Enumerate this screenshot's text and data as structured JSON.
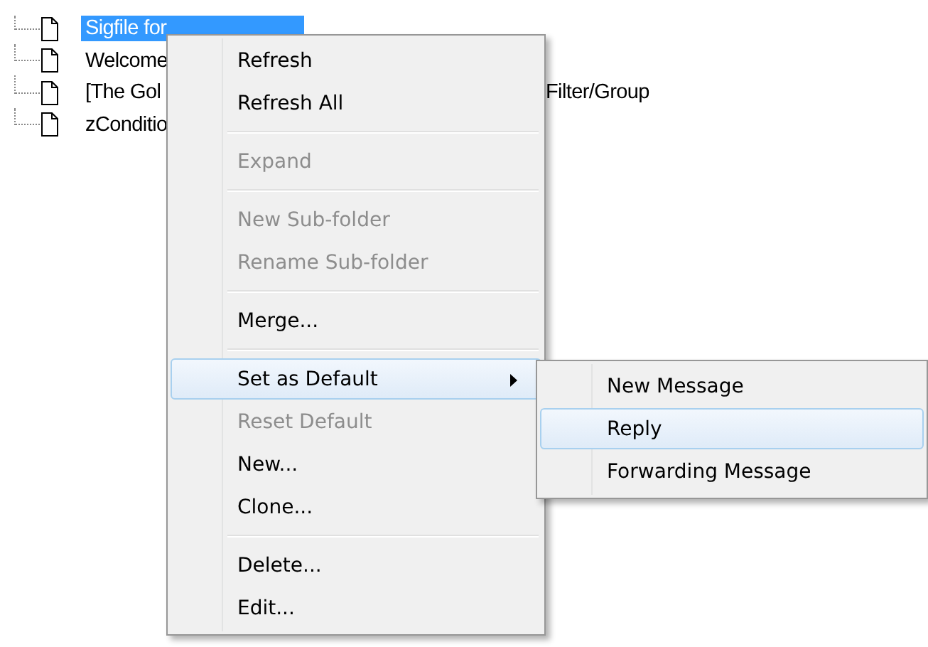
{
  "tree": {
    "items": [
      {
        "label": "Sigfile for",
        "selected": true
      },
      {
        "label": "Welcome",
        "selected": false
      },
      {
        "label": "[The Gol",
        "selected": false,
        "tail": "Filter/Group"
      },
      {
        "label": "zConditio",
        "selected": false
      }
    ]
  },
  "context_menu": {
    "items": [
      {
        "kind": "item",
        "label": "Refresh",
        "disabled": false,
        "selected": false,
        "has_submenu": false
      },
      {
        "kind": "item",
        "label": "Refresh All",
        "disabled": false,
        "selected": false,
        "has_submenu": false
      },
      {
        "kind": "separator"
      },
      {
        "kind": "item",
        "label": "Expand",
        "disabled": true,
        "selected": false,
        "has_submenu": false
      },
      {
        "kind": "separator"
      },
      {
        "kind": "item",
        "label": "New Sub-folder",
        "disabled": true,
        "selected": false,
        "has_submenu": false
      },
      {
        "kind": "item",
        "label": "Rename Sub-folder",
        "disabled": true,
        "selected": false,
        "has_submenu": false
      },
      {
        "kind": "separator"
      },
      {
        "kind": "item",
        "label": "Merge...",
        "disabled": false,
        "selected": false,
        "has_submenu": false
      },
      {
        "kind": "separator"
      },
      {
        "kind": "item",
        "label": "Set as Default",
        "disabled": false,
        "selected": true,
        "has_submenu": true
      },
      {
        "kind": "item",
        "label": "Reset Default",
        "disabled": true,
        "selected": false,
        "has_submenu": false
      },
      {
        "kind": "item",
        "label": "New...",
        "disabled": false,
        "selected": false,
        "has_submenu": false
      },
      {
        "kind": "item",
        "label": "Clone...",
        "disabled": false,
        "selected": false,
        "has_submenu": false
      },
      {
        "kind": "separator"
      },
      {
        "kind": "item",
        "label": "Delete...",
        "disabled": false,
        "selected": false,
        "has_submenu": false
      },
      {
        "kind": "item",
        "label": "Edit...",
        "disabled": false,
        "selected": false,
        "has_submenu": false
      }
    ]
  },
  "submenu": {
    "items": [
      {
        "kind": "item",
        "label": "New Message",
        "disabled": false,
        "selected": false,
        "has_submenu": false
      },
      {
        "kind": "item",
        "label": "Reply",
        "disabled": false,
        "selected": true,
        "has_submenu": false
      },
      {
        "kind": "item",
        "label": "Forwarding Message",
        "disabled": false,
        "selected": false,
        "has_submenu": false
      }
    ]
  }
}
